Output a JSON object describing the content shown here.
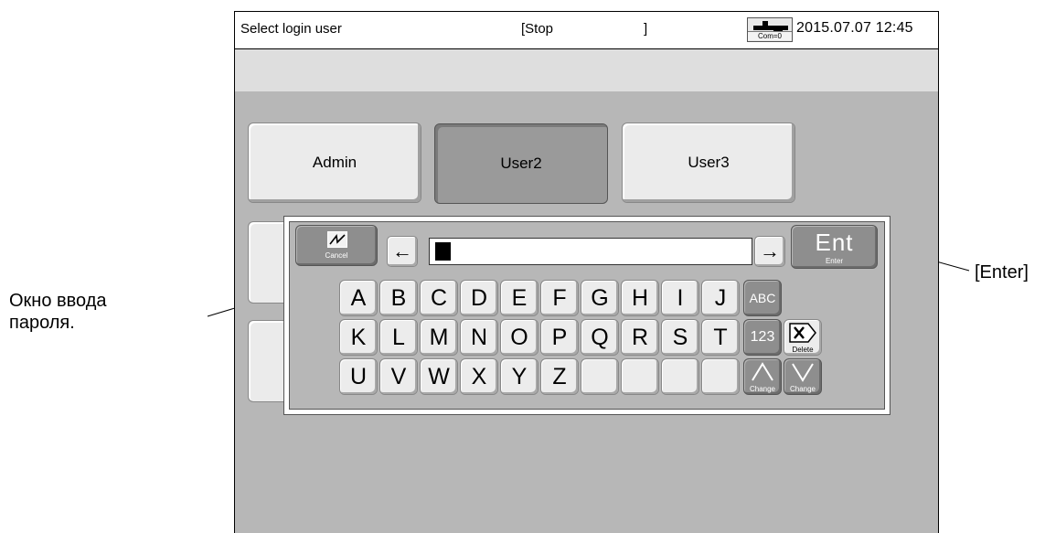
{
  "titlebar": {
    "title": "Select login user",
    "status": "[Stop",
    "status_end": "]",
    "com_label": "Com=0",
    "datetime": "2015.07.07 12:45"
  },
  "users": [
    {
      "label": "Admin",
      "selected": false
    },
    {
      "label": "User2",
      "selected": true
    },
    {
      "label": "User3",
      "selected": false
    }
  ],
  "keyboard": {
    "cancel_label": "Cancel",
    "left_arrow": "←",
    "right_arrow": "→",
    "enter_main": "Ent",
    "enter_sub": "Enter",
    "password_value": "",
    "row1": [
      "A",
      "B",
      "C",
      "D",
      "E",
      "F",
      "G",
      "H",
      "I",
      "J"
    ],
    "row2": [
      "K",
      "L",
      "M",
      "N",
      "O",
      "P",
      "Q",
      "R",
      "S",
      "T"
    ],
    "row3": [
      "U",
      "V",
      "W",
      "X",
      "Y",
      "Z"
    ],
    "abc_label": "ABC",
    "num_label": "123",
    "delete_label": "Delete",
    "change_up_label": "Change",
    "change_down_label": "Change"
  },
  "annotations": {
    "password_window_line1": "Окно ввода",
    "password_window_line2": "пароля.",
    "enter": "[Enter]"
  }
}
